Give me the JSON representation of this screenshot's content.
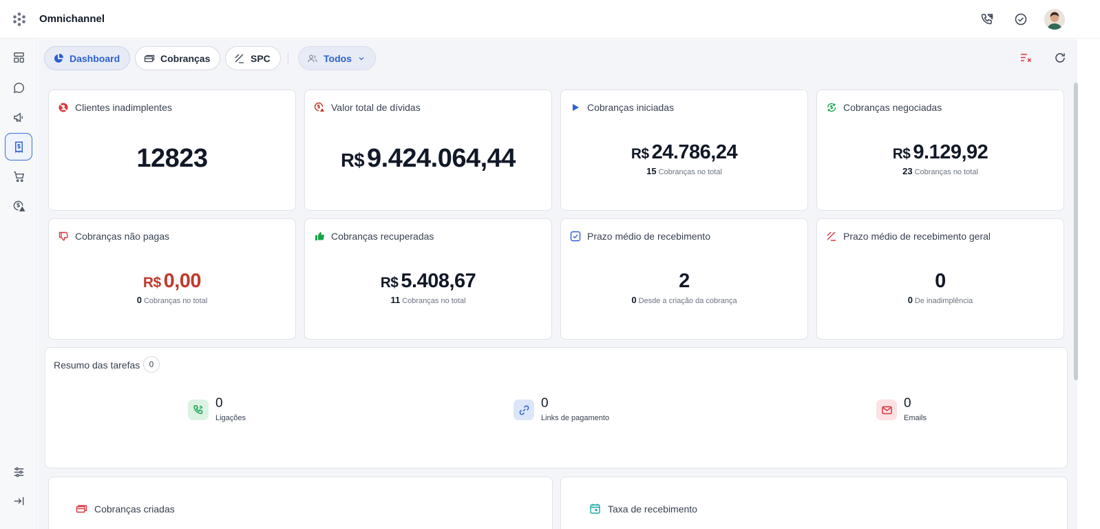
{
  "app": {
    "title": "Omnichannel"
  },
  "toolbar": {
    "tabs": [
      {
        "label": "Dashboard",
        "icon": "pie-chart-icon"
      },
      {
        "label": "Cobranças",
        "icon": "money-icon"
      },
      {
        "label": "SPC",
        "icon": "spc-icon"
      }
    ],
    "filter_label": "Todos"
  },
  "colors": {
    "primary": "#2c5fd1",
    "danger": "#c0392b",
    "success": "#16a34a"
  },
  "cards": [
    {
      "title": "Clientes inadimplentes",
      "icon": "user-block-icon",
      "value": "12823"
    },
    {
      "title": "Valor total de dívidas",
      "icon": "money-alert-icon",
      "currency": "R$",
      "value": "9.424.064,44"
    },
    {
      "title": "Cobranças iniciadas",
      "icon": "play-icon",
      "currency": "R$",
      "value": "24.786,24",
      "count": "15",
      "count_label": "Cobranças no total"
    },
    {
      "title": "Cobranças negociadas",
      "icon": "money-refresh-icon",
      "currency": "R$",
      "value": "9.129,92",
      "count": "23",
      "count_label": "Cobranças no total"
    },
    {
      "title": "Cobranças não pagas",
      "icon": "thumbs-down-icon",
      "currency": "R$",
      "value": "0,00",
      "count": "0",
      "count_label": "Cobranças no total"
    },
    {
      "title": "Cobranças recuperadas",
      "icon": "thumbs-up-icon",
      "currency": "R$",
      "value": "5.408,67",
      "count": "11",
      "count_label": "Cobranças no total"
    },
    {
      "title": "Prazo médio de recebimento",
      "icon": "checkbox-icon",
      "value": "2",
      "count": "0",
      "count_label": "Desde a criação da cobrança"
    },
    {
      "title": "Prazo médio de recebimento geral",
      "icon": "spc-icon",
      "value": "0",
      "count": "0",
      "count_label": "De inadimplência"
    }
  ],
  "tasks": {
    "title": "Resumo das tarefas",
    "count": "0",
    "items": [
      {
        "value": "0",
        "label": "Ligações",
        "icon": "phone-icon"
      },
      {
        "value": "0",
        "label": "Links de pagamento",
        "icon": "link-icon"
      },
      {
        "value": "0",
        "label": "Emails",
        "icon": "mail-icon"
      }
    ]
  },
  "lower": [
    {
      "title": "Cobranças criadas",
      "icon": "money-icon"
    },
    {
      "title": "Taxa de recebimento",
      "icon": "calendar-icon"
    }
  ]
}
